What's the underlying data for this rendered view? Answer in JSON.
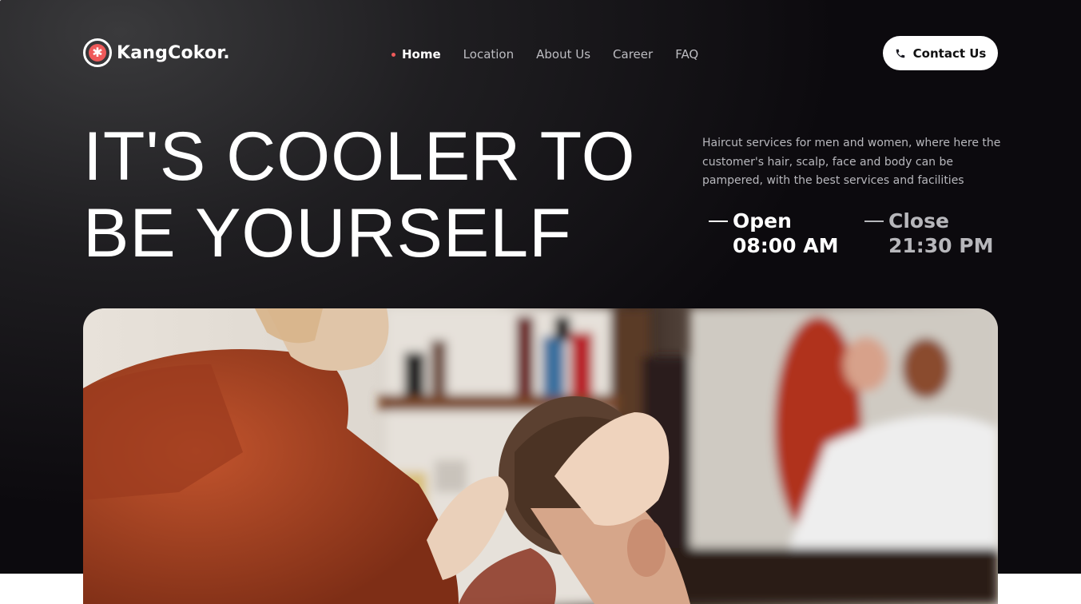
{
  "brand": {
    "name": "KangCokor."
  },
  "nav": {
    "items": [
      {
        "label": "Home",
        "active": true
      },
      {
        "label": "Location",
        "active": false
      },
      {
        "label": "About Us",
        "active": false
      },
      {
        "label": "Career",
        "active": false
      },
      {
        "label": "FAQ",
        "active": false
      }
    ]
  },
  "header": {
    "contact_label": "Contact Us"
  },
  "hero": {
    "headline_line1": "IT'S COOLER TO",
    "headline_line2": "BE YOURSELF",
    "description": "Haircut services for men and women, where here the customer's hair, scalp, face and body can be pampered, with the best services and facilities",
    "open_label": "Open",
    "open_time": "08:00 AM",
    "close_label": "Close",
    "close_time": "21:30 PM"
  },
  "icons": {
    "logo": "asterisk-logo-icon",
    "contact": "phone-icon"
  },
  "colors": {
    "accent": "#ef5a5a",
    "background": "#161417",
    "text": "#ffffff",
    "muted": "#b8b8bd"
  }
}
